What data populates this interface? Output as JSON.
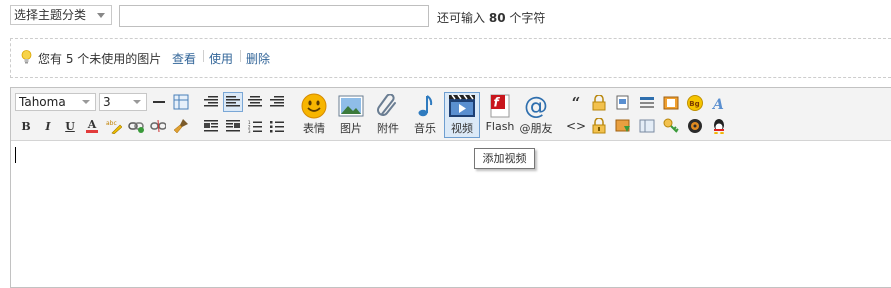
{
  "subject": {
    "category_select": "选择主题分类",
    "title_value": "",
    "char_hint_prefix": "还可输入",
    "char_hint_count": "80",
    "char_hint_suffix": "个字符"
  },
  "notice": {
    "text": "您有 5 个未使用的图片",
    "view": "查看",
    "use": "使用",
    "delete": "删除"
  },
  "toolbar": {
    "font": "Tahoma",
    "size": "3",
    "bold": "B",
    "italic": "I",
    "underline": "U",
    "font_color": "A",
    "quote": "“",
    "code": "<>",
    "large_buttons": [
      {
        "label": "表情",
        "icon": "smiley-icon"
      },
      {
        "label": "图片",
        "icon": "image-icon"
      },
      {
        "label": "附件",
        "icon": "paperclip-icon"
      },
      {
        "label": "音乐",
        "icon": "music-note-icon"
      },
      {
        "label": "视频",
        "icon": "video-icon"
      },
      {
        "label": "Flash",
        "icon": "flash-icon"
      },
      {
        "label": "@朋友",
        "icon": "at-icon"
      }
    ]
  },
  "tooltip": "添加视频",
  "colors": {
    "link": "#336699",
    "accent_active": "#dbe9f7",
    "toolbar_bg": "#f3f3f3"
  }
}
